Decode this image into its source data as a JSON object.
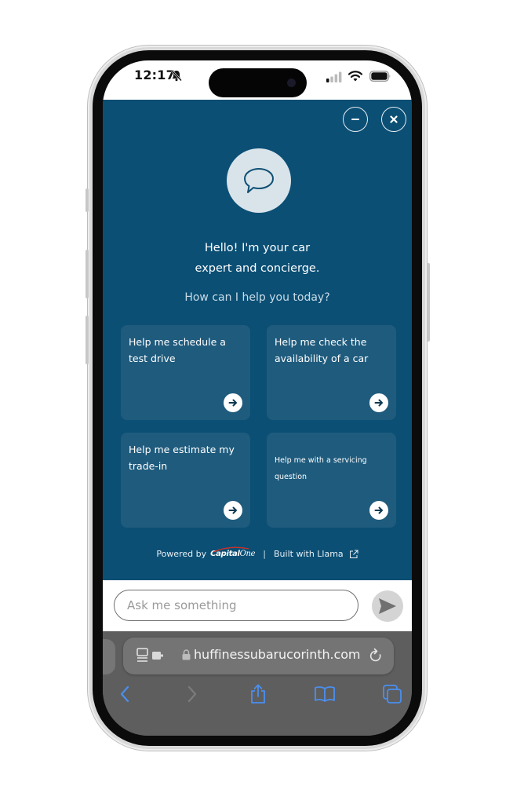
{
  "status_bar": {
    "time": "12:17",
    "icons": [
      "bell-slash-icon",
      "cellular-signal-icon",
      "wifi-icon",
      "battery-icon"
    ]
  },
  "chat": {
    "header_buttons": {
      "minimize": "minimize-icon",
      "close": "close-icon"
    },
    "avatar_icon": "speech-bubble-icon",
    "greeting_line1": "Hello! I'm your car",
    "greeting_line2": "expert and concierge.",
    "prompt": "How can I help you today?",
    "suggestions": [
      {
        "label": "Help me schedule a test drive",
        "icon": "arrow-right-icon"
      },
      {
        "label": "Help me check the availability of a car",
        "icon": "arrow-right-icon"
      },
      {
        "label": "Help me estimate my trade-in",
        "icon": "arrow-right-icon"
      },
      {
        "label": "Help me with a servicing question",
        "icon": "arrow-right-icon"
      }
    ],
    "footer": {
      "powered_by": "Powered by",
      "brand_capital": "Capital",
      "brand_one": "One",
      "separator": "|",
      "built_with": "Built with Llama",
      "external_icon": "external-link-icon"
    },
    "colors": {
      "background": "#0b4f75",
      "card": "#1f5b7d",
      "avatar": "#d9e4ea"
    }
  },
  "input": {
    "placeholder": "Ask me something",
    "value": "",
    "send_icon": "send-icon"
  },
  "browser": {
    "url": "huffinessubarucorinth.com",
    "toolbar": [
      "back-icon",
      "forward-icon",
      "share-icon",
      "bookmarks-icon",
      "tabs-icon"
    ],
    "accent": "#4a8ff0"
  }
}
